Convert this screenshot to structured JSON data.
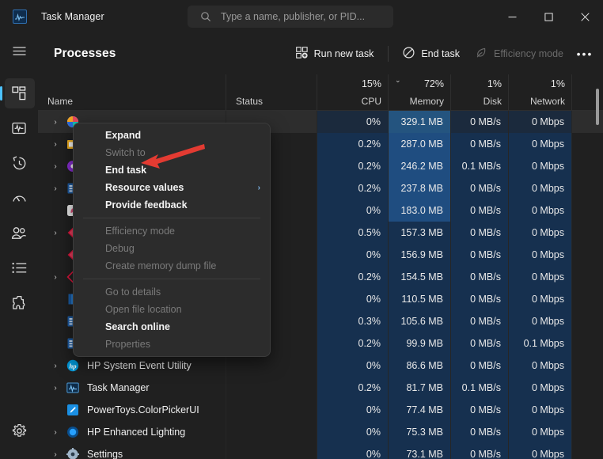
{
  "window": {
    "title": "Task Manager",
    "app_icon": "task-manager-icon",
    "minimize_label": "—",
    "maximize_label": "☐",
    "close_label": "✕"
  },
  "search": {
    "placeholder": "Type a name, publisher, or PID...",
    "value": "",
    "icon": "search-icon"
  },
  "sidebar": {
    "hamburger_label": "☰",
    "items": [
      {
        "name": "processes",
        "label": "Processes",
        "selected": true
      },
      {
        "name": "performance",
        "label": "Performance",
        "selected": false
      },
      {
        "name": "app-history",
        "label": "App history",
        "selected": false
      },
      {
        "name": "startup-apps",
        "label": "Startup apps",
        "selected": false
      },
      {
        "name": "users",
        "label": "Users",
        "selected": false
      },
      {
        "name": "details",
        "label": "Details",
        "selected": false
      },
      {
        "name": "services",
        "label": "Services",
        "selected": false
      }
    ],
    "settings_label": "Settings"
  },
  "page": {
    "title": "Processes"
  },
  "toolbar": {
    "run_new_task": "Run new task",
    "end_task": "End task",
    "efficiency_mode": "Efficiency mode",
    "more_label": "•••"
  },
  "columns": [
    {
      "key": "name",
      "label": "Name",
      "pct": "",
      "sorted": false
    },
    {
      "key": "status",
      "label": "Status",
      "pct": "",
      "sorted": false
    },
    {
      "key": "cpu",
      "label": "CPU",
      "pct": "15%",
      "sorted": false
    },
    {
      "key": "memory",
      "label": "Memory",
      "pct": "72%",
      "sorted": true,
      "sort_dir": "desc",
      "sort_glyph": "⌄"
    },
    {
      "key": "disk",
      "label": "Disk",
      "pct": "1%",
      "sorted": false
    },
    {
      "key": "network",
      "label": "Network",
      "pct": "1%",
      "sorted": false
    }
  ],
  "rows": [
    {
      "name": "",
      "status": "",
      "cpu": "0%",
      "memory": "329.1 MB",
      "disk": "0 MB/s",
      "network": "0 Mbps",
      "expandable": true,
      "selected": true,
      "icon": "colorful-app-icon",
      "obscured": true,
      "mem_heat": 3,
      "cpu_heat": 0,
      "disk_heat": 0,
      "net_heat": 0
    },
    {
      "name": "",
      "status": "",
      "cpu": "0.2%",
      "memory": "287.0 MB",
      "disk": "0 MB/s",
      "network": "0 Mbps",
      "expandable": true,
      "selected": false,
      "icon": "yellow-folder-icon",
      "obscured": true,
      "mem_heat": 3,
      "cpu_heat": 1,
      "disk_heat": 1,
      "net_heat": 1
    },
    {
      "name": "",
      "status": "",
      "cpu": "0.2%",
      "memory": "246.2 MB",
      "disk": "0.1 MB/s",
      "network": "0 Mbps",
      "expandable": true,
      "selected": false,
      "icon": "blue-circle-icon",
      "obscured": true,
      "mem_heat": 3,
      "cpu_heat": 1,
      "disk_heat": 1,
      "net_heat": 1
    },
    {
      "name": "",
      "status": "",
      "cpu": "0.2%",
      "memory": "237.8 MB",
      "disk": "0 MB/s",
      "network": "0 Mbps",
      "expandable": true,
      "selected": false,
      "icon": "window-app-icon",
      "obscured": true,
      "mem_heat": 3,
      "cpu_heat": 1,
      "disk_heat": 1,
      "net_heat": 1
    },
    {
      "name": "",
      "status": "",
      "cpu": "0%",
      "memory": "183.0 MB",
      "disk": "0 MB/s",
      "network": "0 Mbps",
      "expandable": false,
      "selected": false,
      "icon": "white-app-icon",
      "obscured": true,
      "mem_heat": 3,
      "cpu_heat": 1,
      "disk_heat": 1,
      "net_heat": 1
    },
    {
      "name": "",
      "status": "",
      "cpu": "0.5%",
      "memory": "157.3 MB",
      "disk": "0 MB/s",
      "network": "0 Mbps",
      "expandable": true,
      "selected": false,
      "icon": "red-diamond-icon",
      "obscured": true,
      "mem_heat": 1,
      "cpu_heat": 1,
      "disk_heat": 1,
      "net_heat": 1
    },
    {
      "name": "",
      "status": "",
      "cpu": "0%",
      "memory": "156.9 MB",
      "disk": "0 MB/s",
      "network": "0 Mbps",
      "expandable": false,
      "selected": false,
      "icon": "red-diamond-icon",
      "obscured": true,
      "mem_heat": 1,
      "cpu_heat": 1,
      "disk_heat": 1,
      "net_heat": 1
    },
    {
      "name": "",
      "status": "",
      "cpu": "0.2%",
      "memory": "154.5 MB",
      "disk": "0 MB/s",
      "network": "0 Mbps",
      "expandable": true,
      "selected": false,
      "icon": "red-outline-icon",
      "obscured": true,
      "mem_heat": 1,
      "cpu_heat": 1,
      "disk_heat": 1,
      "net_heat": 1
    },
    {
      "name": "",
      "status": "",
      "cpu": "0%",
      "memory": "110.5 MB",
      "disk": "0 MB/s",
      "network": "0 Mbps",
      "expandable": false,
      "selected": false,
      "icon": "blue-book-icon",
      "obscured": true,
      "mem_heat": 1,
      "cpu_heat": 1,
      "disk_heat": 1,
      "net_heat": 1
    },
    {
      "name": "",
      "status": "",
      "cpu": "0.3%",
      "memory": "105.6 MB",
      "disk": "0 MB/s",
      "network": "0 Mbps",
      "expandable": false,
      "selected": false,
      "icon": "window-app-icon",
      "obscured": true,
      "mem_heat": 1,
      "cpu_heat": 1,
      "disk_heat": 1,
      "net_heat": 1
    },
    {
      "name": "",
      "status": "",
      "cpu": "0.2%",
      "memory": "99.9 MB",
      "disk": "0 MB/s",
      "network": "0.1 Mbps",
      "expandable": false,
      "selected": false,
      "icon": "window-app-icon",
      "obscured": true,
      "mem_heat": 1,
      "cpu_heat": 1,
      "disk_heat": 1,
      "net_heat": 1
    },
    {
      "name": "HP System Event Utility",
      "status": "",
      "cpu": "0%",
      "memory": "86.6 MB",
      "disk": "0 MB/s",
      "network": "0 Mbps",
      "expandable": true,
      "selected": false,
      "icon": "hp-icon",
      "obscured": false,
      "mem_heat": 1,
      "cpu_heat": 1,
      "disk_heat": 1,
      "net_heat": 1
    },
    {
      "name": "Task Manager",
      "status": "",
      "cpu": "0.2%",
      "memory": "81.7 MB",
      "disk": "0.1 MB/s",
      "network": "0 Mbps",
      "expandable": true,
      "selected": false,
      "icon": "task-manager-icon",
      "obscured": false,
      "mem_heat": 1,
      "cpu_heat": 1,
      "disk_heat": 1,
      "net_heat": 1
    },
    {
      "name": "PowerToys.ColorPickerUI",
      "status": "",
      "cpu": "0%",
      "memory": "77.4 MB",
      "disk": "0 MB/s",
      "network": "0 Mbps",
      "expandable": false,
      "selected": false,
      "icon": "color-picker-icon",
      "obscured": false,
      "mem_heat": 1,
      "cpu_heat": 1,
      "disk_heat": 1,
      "net_heat": 1
    },
    {
      "name": "HP Enhanced Lighting",
      "status": "",
      "cpu": "0%",
      "memory": "75.3 MB",
      "disk": "0 MB/s",
      "network": "0 Mbps",
      "expandable": true,
      "selected": false,
      "icon": "blue-dot-icon",
      "obscured": false,
      "mem_heat": 1,
      "cpu_heat": 1,
      "disk_heat": 1,
      "net_heat": 1
    },
    {
      "name": "Settings",
      "status": "",
      "cpu": "0%",
      "memory": "73.1 MB",
      "disk": "0 MB/s",
      "network": "0 Mbps",
      "expandable": true,
      "selected": false,
      "icon": "settings-gear-icon",
      "obscured": false,
      "mem_heat": 1,
      "cpu_heat": 1,
      "disk_heat": 1,
      "net_heat": 1
    }
  ],
  "context_menu": {
    "items": [
      {
        "label": "Expand",
        "enabled": true,
        "submenu": false
      },
      {
        "label": "Switch to",
        "enabled": false,
        "submenu": false
      },
      {
        "label": "End task",
        "enabled": true,
        "submenu": false
      },
      {
        "label": "Resource values",
        "enabled": true,
        "submenu": true,
        "submenu_glyph": "›"
      },
      {
        "label": "Provide feedback",
        "enabled": true,
        "submenu": false
      },
      {
        "separator": true
      },
      {
        "label": "Efficiency mode",
        "enabled": false,
        "submenu": false
      },
      {
        "label": "Debug",
        "enabled": false,
        "submenu": false
      },
      {
        "label": "Create memory dump file",
        "enabled": false,
        "submenu": false
      },
      {
        "separator": true
      },
      {
        "label": "Go to details",
        "enabled": false,
        "submenu": false
      },
      {
        "label": "Open file location",
        "enabled": false,
        "submenu": false
      },
      {
        "label": "Search online",
        "enabled": true,
        "submenu": false
      },
      {
        "label": "Properties",
        "enabled": false,
        "submenu": false
      }
    ]
  },
  "annotation": {
    "arrow_color": "#e33b32",
    "points_to": "End task"
  },
  "colors": {
    "accent": "#4cc2ff",
    "window_bg": "#202020",
    "menu_bg": "#2c2c2c",
    "heat_blue": "#1f4d80",
    "close_hover": "#c42b1c"
  }
}
